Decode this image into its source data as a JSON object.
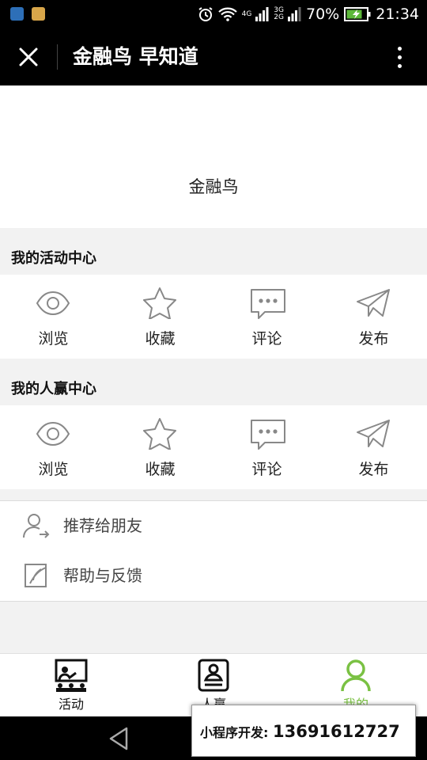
{
  "status_bar": {
    "network_top": "4G",
    "network_mid": "3G",
    "network_bot": "2G",
    "battery": "70%",
    "time": "21:34"
  },
  "title_bar": {
    "title": "金融鸟 早知道",
    "close_icon": "close-icon",
    "more_icon": "more-vertical-icon"
  },
  "profile": {
    "name": "金融鸟"
  },
  "activity_center": {
    "title": "我的活动中心",
    "items": [
      {
        "label": "浏览",
        "icon": "eye-icon"
      },
      {
        "label": "收藏",
        "icon": "star-icon"
      },
      {
        "label": "评论",
        "icon": "comment-icon"
      },
      {
        "label": "发布",
        "icon": "paper-plane-icon"
      }
    ]
  },
  "renying_center": {
    "title": "我的人赢中心",
    "items": [
      {
        "label": "浏览",
        "icon": "eye-icon"
      },
      {
        "label": "收藏",
        "icon": "star-icon"
      },
      {
        "label": "评论",
        "icon": "comment-icon"
      },
      {
        "label": "发布",
        "icon": "paper-plane-icon"
      }
    ]
  },
  "menu": [
    {
      "label": "推荐给朋友",
      "icon": "share-user-icon"
    },
    {
      "label": "帮助与反馈",
      "icon": "feedback-icon"
    }
  ],
  "tab_bar": {
    "tabs": [
      {
        "label": "活动",
        "icon": "presentation-icon",
        "active": false
      },
      {
        "label": "人赢",
        "icon": "profile-card-icon",
        "active": false
      },
      {
        "label": "我的",
        "icon": "user-icon",
        "active": true
      }
    ],
    "active_color": "#7ac143"
  },
  "overlay": {
    "label": "小程序开发:",
    "phone": "13691612727"
  }
}
